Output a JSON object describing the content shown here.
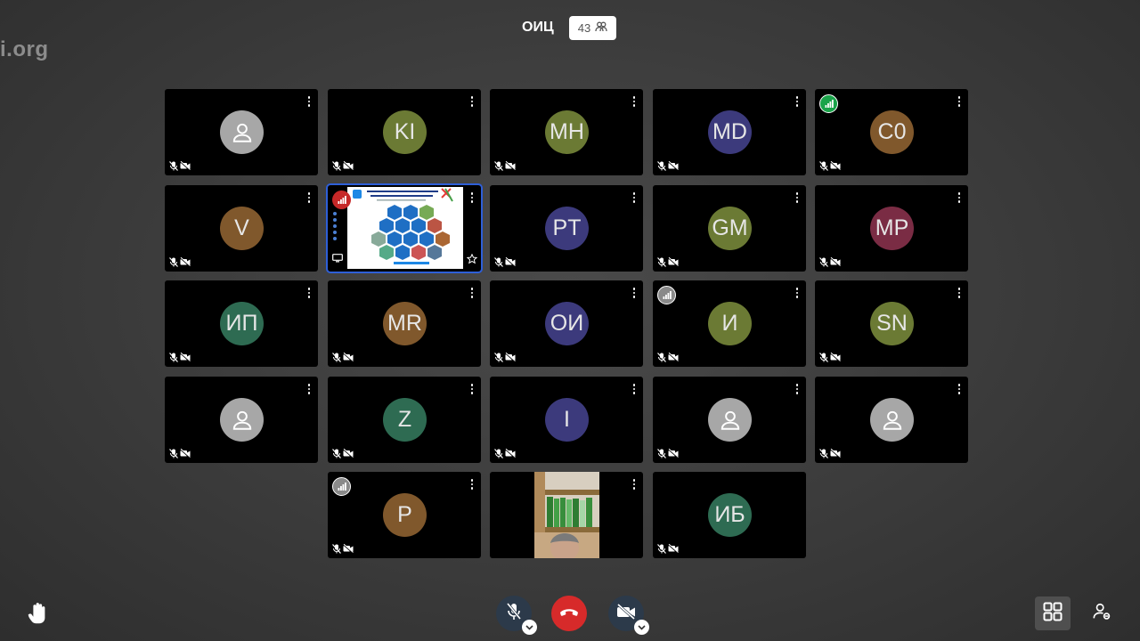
{
  "watermark": "i.org",
  "header": {
    "room_name": "ОИЦ",
    "participant_count": "43"
  },
  "tiles": [
    {
      "initials": "",
      "color": "#a7a7a7",
      "generic": true
    },
    {
      "initials": "KI",
      "color": "#6b7a34"
    },
    {
      "initials": "MH",
      "color": "#6b7a34"
    },
    {
      "initials": "MD",
      "color": "#3c3a7c"
    },
    {
      "initials": "C0",
      "color": "#80582c",
      "signal": "green"
    },
    {
      "initials": "V",
      "color": "#80582c"
    },
    {
      "screen_share": true,
      "signal": "red"
    },
    {
      "initials": "PT",
      "color": "#3c3a7c"
    },
    {
      "initials": "GM",
      "color": "#6b7a34"
    },
    {
      "initials": "MP",
      "color": "#7a2c44"
    },
    {
      "initials": "ИП",
      "color": "#2e6b52"
    },
    {
      "initials": "MR",
      "color": "#80582c"
    },
    {
      "initials": "ОИ",
      "color": "#3c3a7c"
    },
    {
      "initials": "И",
      "color": "#6b7a34",
      "signal": "gray"
    },
    {
      "initials": "SN",
      "color": "#6b7a34"
    },
    {
      "initials": "",
      "color": "#a7a7a7",
      "generic": true
    },
    {
      "initials": "Z",
      "color": "#2e6b52"
    },
    {
      "initials": "I",
      "color": "#3c3a7c"
    },
    {
      "initials": "",
      "color": "#a7a7a7",
      "generic": true
    },
    {
      "initials": "",
      "color": "#a7a7a7",
      "generic": true
    },
    {
      "initials": "P",
      "color": "#80582c",
      "signal": "gray"
    },
    {
      "camera": true
    },
    {
      "initials": "ИБ",
      "color": "#2e6b52"
    }
  ],
  "toolbar": {
    "raise_hand": "raise-hand-icon",
    "mic": "mic-off-icon",
    "hangup": "hangup-icon",
    "camera": "camera-off-icon",
    "layout": "grid-layout-icon",
    "participants": "participants-icon"
  }
}
